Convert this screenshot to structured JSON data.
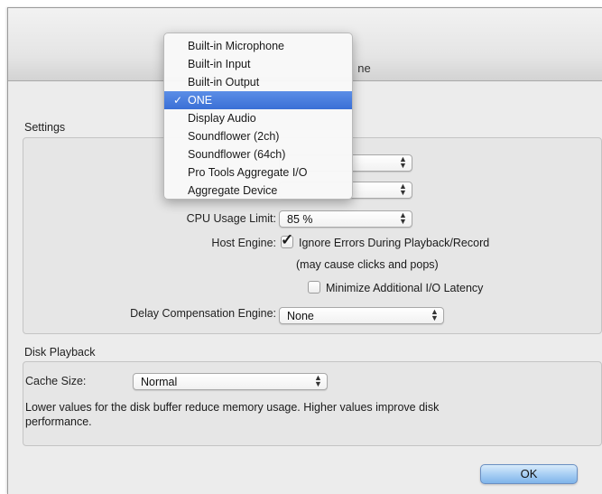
{
  "window": {
    "title_visible": "ne"
  },
  "settings": {
    "section_label": "Settings",
    "cpu_label": "CPU Usage Limit:",
    "cpu_value": "85 %",
    "host_engine_label": "Host Engine:",
    "ignore_errors_label": "Ignore Errors During Playback/Record",
    "ignore_errors_checked": true,
    "ignore_errors_note": "(may cause clicks and pops)",
    "minimize_latency_label": "Minimize Additional I/O Latency",
    "minimize_latency_checked": false,
    "delay_comp_label": "Delay Compensation Engine:",
    "delay_comp_value": "None"
  },
  "disk_playback": {
    "section_label": "Disk Playback",
    "cache_label": "Cache Size:",
    "cache_value": "Normal",
    "description_line1": "Lower values for the disk buffer reduce memory usage.  Higher values improve disk",
    "description_line2": "performance."
  },
  "buttons": {
    "ok_label": "OK"
  },
  "device_menu": {
    "items": [
      {
        "label": "Built-in Microphone",
        "selected": false
      },
      {
        "label": "Built-in Input",
        "selected": false
      },
      {
        "label": "Built-in Output",
        "selected": false
      },
      {
        "label": "ONE",
        "selected": true
      },
      {
        "label": "Display Audio",
        "selected": false
      },
      {
        "label": "Soundflower (2ch)",
        "selected": false
      },
      {
        "label": "Soundflower (64ch)",
        "selected": false
      },
      {
        "label": "Pro Tools Aggregate I/O",
        "selected": false
      },
      {
        "label": "Aggregate Device",
        "selected": false
      }
    ],
    "check_glyph": "✓"
  },
  "colors": {
    "selection_blue": "#3a6fd6",
    "ok_button_blue": "#a9cff4",
    "window_bg": "#ececec"
  }
}
